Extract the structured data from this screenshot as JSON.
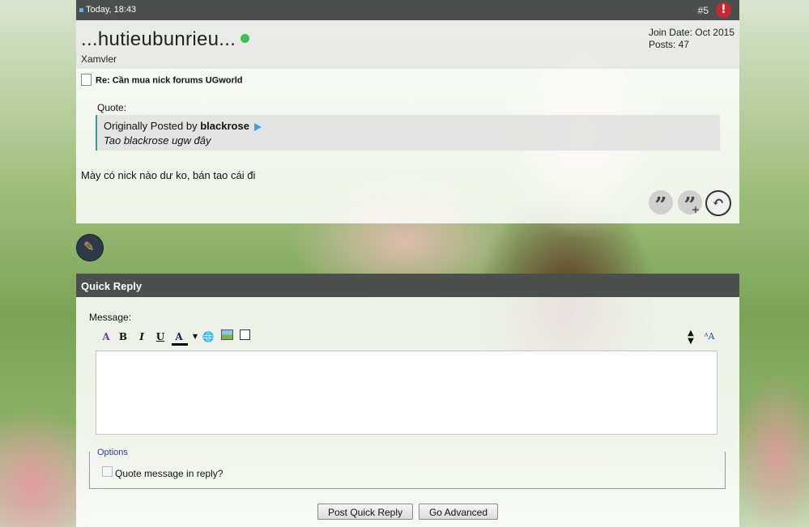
{
  "post": {
    "timestamp": "Today, 18:43",
    "number": "#5",
    "report_icon": "exclamation-icon",
    "username": "...hutieubunrieu...",
    "user_title": "Xamvler",
    "join_date": "Join Date: Oct 2015",
    "posts_count": "Posts: 47",
    "title": "Re: Cần mua nick forums UGworld",
    "quote_label": "Quote:",
    "quote_prefix": "Originally Posted by ",
    "quote_author": "blackrose",
    "quote_text": "Tao blackrose ugw đây",
    "message": "Mày có nick nào dư ko, bán tao cái đi",
    "colors": {
      "header": "#4b4f4e",
      "online": "#3cc05a",
      "report": "#c8282f",
      "quote_border": "#3b9a8a"
    }
  },
  "quick_reply": {
    "title": "Quick Reply",
    "message_label": "Message:",
    "options_legend": "Options",
    "quote_checkbox_label": "Quote message in reply?",
    "quote_checkbox_checked": false,
    "post_button": "Post Quick Reply",
    "advanced_button": "Go Advanced",
    "editor_value": ""
  }
}
